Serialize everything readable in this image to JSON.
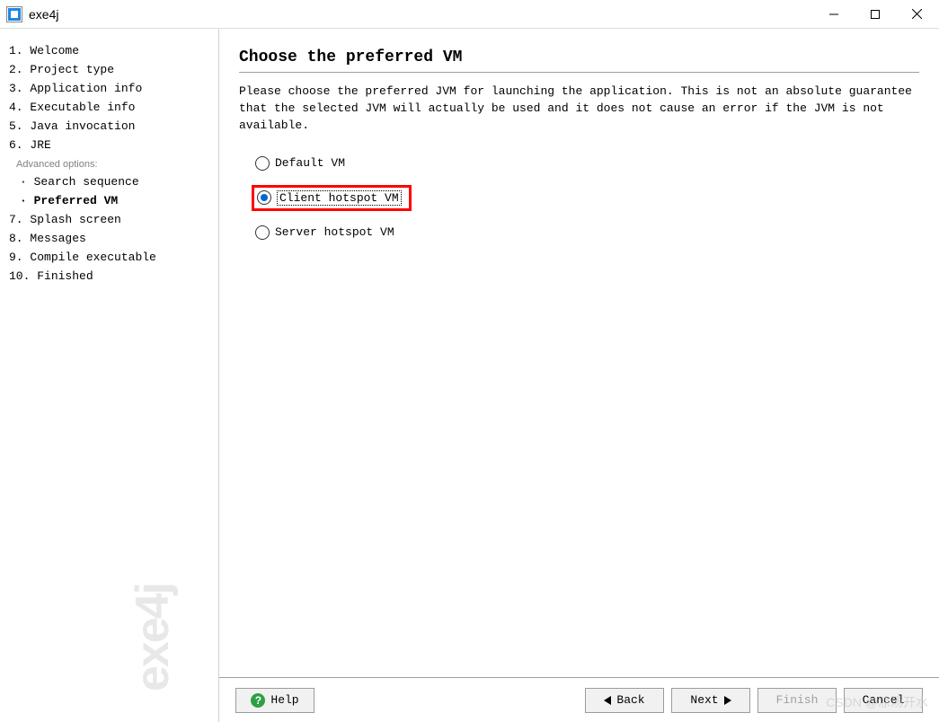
{
  "window": {
    "title": "exe4j"
  },
  "nav": {
    "items": [
      {
        "n": "1.",
        "label": "Welcome"
      },
      {
        "n": "2.",
        "label": "Project type"
      },
      {
        "n": "3.",
        "label": "Application info"
      },
      {
        "n": "4.",
        "label": "Executable info"
      },
      {
        "n": "5.",
        "label": "Java invocation"
      },
      {
        "n": "6.",
        "label": "JRE"
      }
    ],
    "adv_label": "Advanced options:",
    "sub": [
      {
        "label": "Search sequence",
        "bold": false
      },
      {
        "label": "Preferred VM",
        "bold": true
      }
    ],
    "items2": [
      {
        "n": "7.",
        "label": "Splash screen"
      },
      {
        "n": "8.",
        "label": "Messages"
      },
      {
        "n": "9.",
        "label": "Compile executable"
      },
      {
        "n": "10.",
        "label": "Finished"
      }
    ]
  },
  "watermark_side": "exe4j",
  "page": {
    "title": "Choose the preferred VM",
    "desc": "Please choose the preferred JVM for launching the application. This is not an absolute guarantee that the selected JVM will actually be used and it does not cause an error if the JVM is not available."
  },
  "radios": {
    "default": "Default VM",
    "client": "Client hotspot VM",
    "server": "Server hotspot VM"
  },
  "footer": {
    "help": "Help",
    "back": "Back",
    "next": "Next",
    "finish": "Finish",
    "cancel": "Cancel"
  },
  "csdn": "CSDN @凉汤开水"
}
